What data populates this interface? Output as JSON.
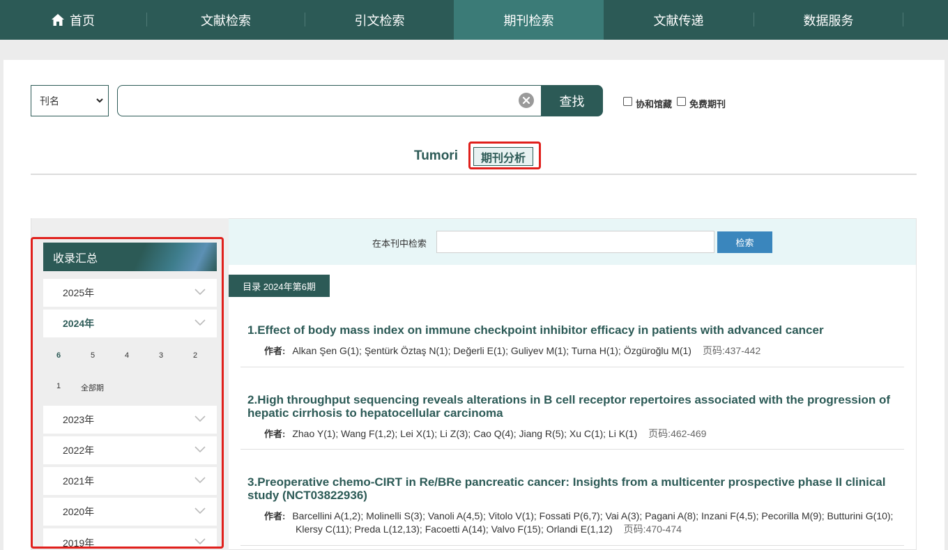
{
  "nav": {
    "home_label": "首页",
    "items": [
      "文献检索",
      "引文检索",
      "期刊检索",
      "文献传递",
      "数据服务"
    ],
    "active": "期刊检索"
  },
  "search": {
    "field_select": "刊名",
    "query_value": "",
    "button_label": "查找",
    "option_holdings": "协和馆藏",
    "option_free": "免费期刊"
  },
  "journal": {
    "name": "Tumori",
    "analysis_button": "期刊分析"
  },
  "sidebar": {
    "heading": "收录汇总",
    "years_top": [
      {
        "label": "2025年"
      },
      {
        "label": "2024年"
      }
    ],
    "issues_2024": [
      "6",
      "5",
      "4",
      "3",
      "2",
      "1",
      "全部期"
    ],
    "active_issue": "6",
    "years_bottom": [
      {
        "label": "2023年"
      },
      {
        "label": "2022年"
      },
      {
        "label": "2021年"
      },
      {
        "label": "2020年"
      },
      {
        "label": "2019年"
      }
    ]
  },
  "inner_search": {
    "label": "在本刊中检索",
    "value": "",
    "button_label": "检索"
  },
  "toc": {
    "label": "目录 2024年第6期",
    "author_label": "作者:",
    "pages_label": "页码:",
    "articles": [
      {
        "num": "1.",
        "title": "Effect of body mass index on immune checkpoint inhibitor efficacy in patients with advanced cancer",
        "authors": "Alkan Şen G(1);  Şentürk Öztaş N(1);  Değerli E(1);  Guliyev M(1);  Turna H(1);  Özgüroğlu M(1)",
        "pages": "437-442"
      },
      {
        "num": "2.",
        "title": "High throughput sequencing reveals alterations in B cell receptor repertoires associated with the progression of hepatic cirrhosis to hepatocellular carcinoma",
        "authors": "Zhao Y(1);  Wang F(1,2);  Lei X(1);  Li Z(3);  Cao Q(4);  Jiang R(5);  Xu C(1);  Li K(1)",
        "pages": "462-469"
      },
      {
        "num": "3.",
        "title": "Preoperative chemo-CIRT in Re/BRe pancreatic cancer: Insights from a multicenter prospective phase II clinical study (NCT03822936)",
        "authors": "Barcellini A(1,2);  Molinelli S(3);  Vanoli A(4,5);  Vitolo V(1);  Fossati P(6,7);  Vai A(3);  Pagani A(8);  Inzani F(4,5);  Pecorilla M(9);  Butturini G(10);  Klersy C(11);  Preda L(12,13);  Facoetti A(14);  Valvo F(15);  Orlandi E(1,12)",
        "pages": "470-474"
      }
    ]
  },
  "colors": {
    "primary": "#2c5a56",
    "nav_active": "#3b7b77",
    "highlight_outline": "#e0201c",
    "inner_search_bg": "#e8f6f7",
    "inner_button": "#3a86bd"
  }
}
